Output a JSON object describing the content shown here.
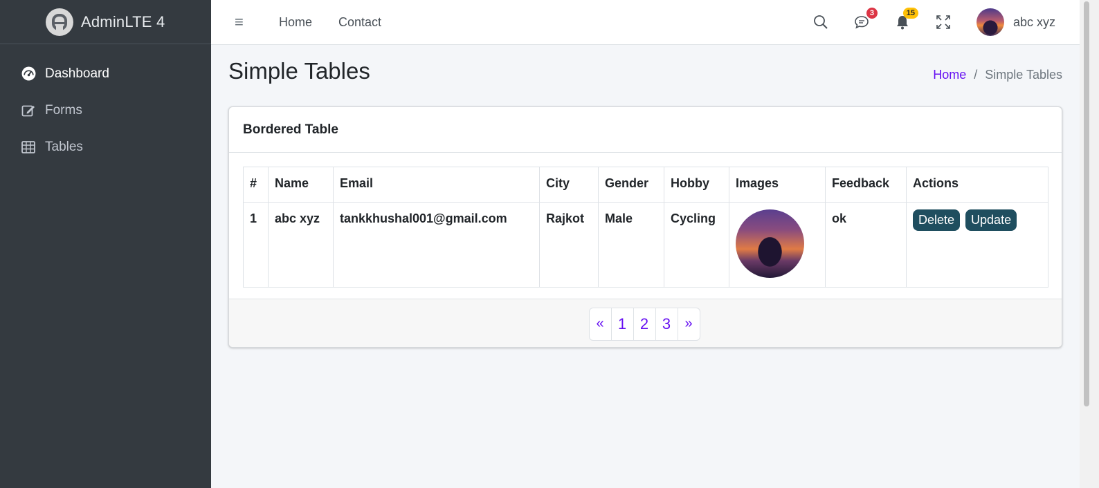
{
  "brand": {
    "name": "AdminLTE 4",
    "logo_icon": "adminlte-logo-icon"
  },
  "sidebar": {
    "items": [
      {
        "label": "Dashboard",
        "icon": "speedometer-icon",
        "active": true
      },
      {
        "label": "Forms",
        "icon": "pencil-square-icon",
        "active": false
      },
      {
        "label": "Tables",
        "icon": "table-icon",
        "active": false
      }
    ]
  },
  "topbar": {
    "menu_icon": "≡",
    "links": [
      "Home",
      "Contact"
    ],
    "messages_badge": "3",
    "notifications_badge": "15",
    "user_name": "abc xyz"
  },
  "header": {
    "title": "Simple Tables",
    "breadcrumb": {
      "home": "Home",
      "separator": "/",
      "current": "Simple Tables"
    }
  },
  "card": {
    "title": "Bordered Table",
    "columns": [
      "#",
      "Name",
      "Email",
      "City",
      "Gender",
      "Hobby",
      "Images",
      "Feedback",
      "Actions"
    ],
    "rows": [
      {
        "id": "1",
        "name": "abc xyz",
        "email": "tankkhushal001@gmail.com",
        "city": "Rajkot",
        "gender": "Male",
        "hobby": "Cycling",
        "feedback": "ok",
        "delete_label": "Delete",
        "update_label": "Update"
      }
    ],
    "pagination": {
      "prev": "«",
      "pages": [
        "1",
        "2",
        "3"
      ],
      "next": "»"
    }
  },
  "colors": {
    "sidebar_bg": "#343a40",
    "link": "#6610f2",
    "button": "#1f4e5f",
    "badge_danger": "#dc3545",
    "badge_warning": "#ffc107"
  }
}
